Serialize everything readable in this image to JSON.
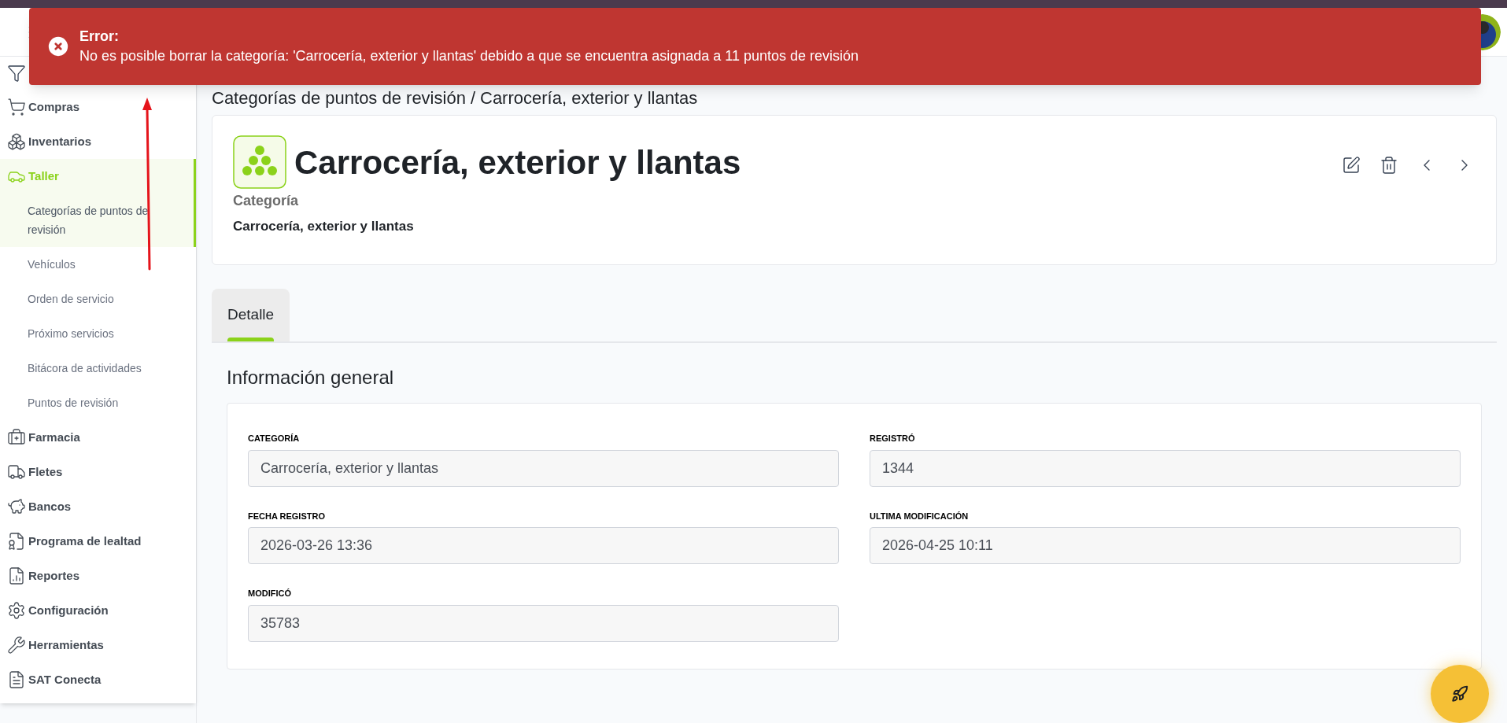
{
  "toast": {
    "title": "Error:",
    "message": "No es posible borrar la categoría: 'Carrocería, exterior y llantas' debido a que se encuentra asignada a 11 puntos de revisión"
  },
  "sidebar": {
    "items": [
      {
        "label": "Compras",
        "selected": false
      },
      {
        "label": "Inventarios",
        "selected": false
      },
      {
        "label": "Taller",
        "selected": true,
        "children": [
          {
            "label": "Categorías de puntos de revisión",
            "selected": true
          },
          {
            "label": "Vehículos",
            "selected": false
          },
          {
            "label": "Orden de servicio",
            "selected": false
          },
          {
            "label": "Próximo servicios",
            "selected": false
          },
          {
            "label": "Bitácora de actividades",
            "selected": false
          },
          {
            "label": "Puntos de revisión",
            "selected": false
          }
        ]
      },
      {
        "label": "Farmacia",
        "selected": false
      },
      {
        "label": "Fletes",
        "selected": false
      },
      {
        "label": "Bancos",
        "selected": false
      },
      {
        "label": "Programa de lealtad",
        "selected": false
      },
      {
        "label": "Reportes",
        "selected": false
      },
      {
        "label": "Configuración",
        "selected": false
      },
      {
        "label": "Herramientas",
        "selected": false
      },
      {
        "label": "SAT Conecta",
        "selected": false
      }
    ]
  },
  "breadcrumb": {
    "parent": "Categorías de puntos de revisión",
    "separator": "/",
    "current": "Carrocería, exterior y llantas"
  },
  "record": {
    "title": "Carrocería, exterior y llantas",
    "subtitle_label": "Categoría",
    "subtitle": "Carrocería, exterior y llantas"
  },
  "tabs": [
    {
      "label": "Detalle",
      "selected": true
    }
  ],
  "section": {
    "title": "Información general",
    "fields": [
      {
        "label": "CATEGORÍA",
        "value": "Carrocería, exterior y llantas"
      },
      {
        "label": "REGISTRÓ",
        "value": "1344"
      },
      {
        "label": "FECHA REGISTRO",
        "value": "2026-03-26 13:36"
      },
      {
        "label": "ULTIMA MODIFICACIÓN",
        "value": "2026-04-25 10:11"
      },
      {
        "label": "MODIFICÓ",
        "value": "35783"
      }
    ]
  }
}
